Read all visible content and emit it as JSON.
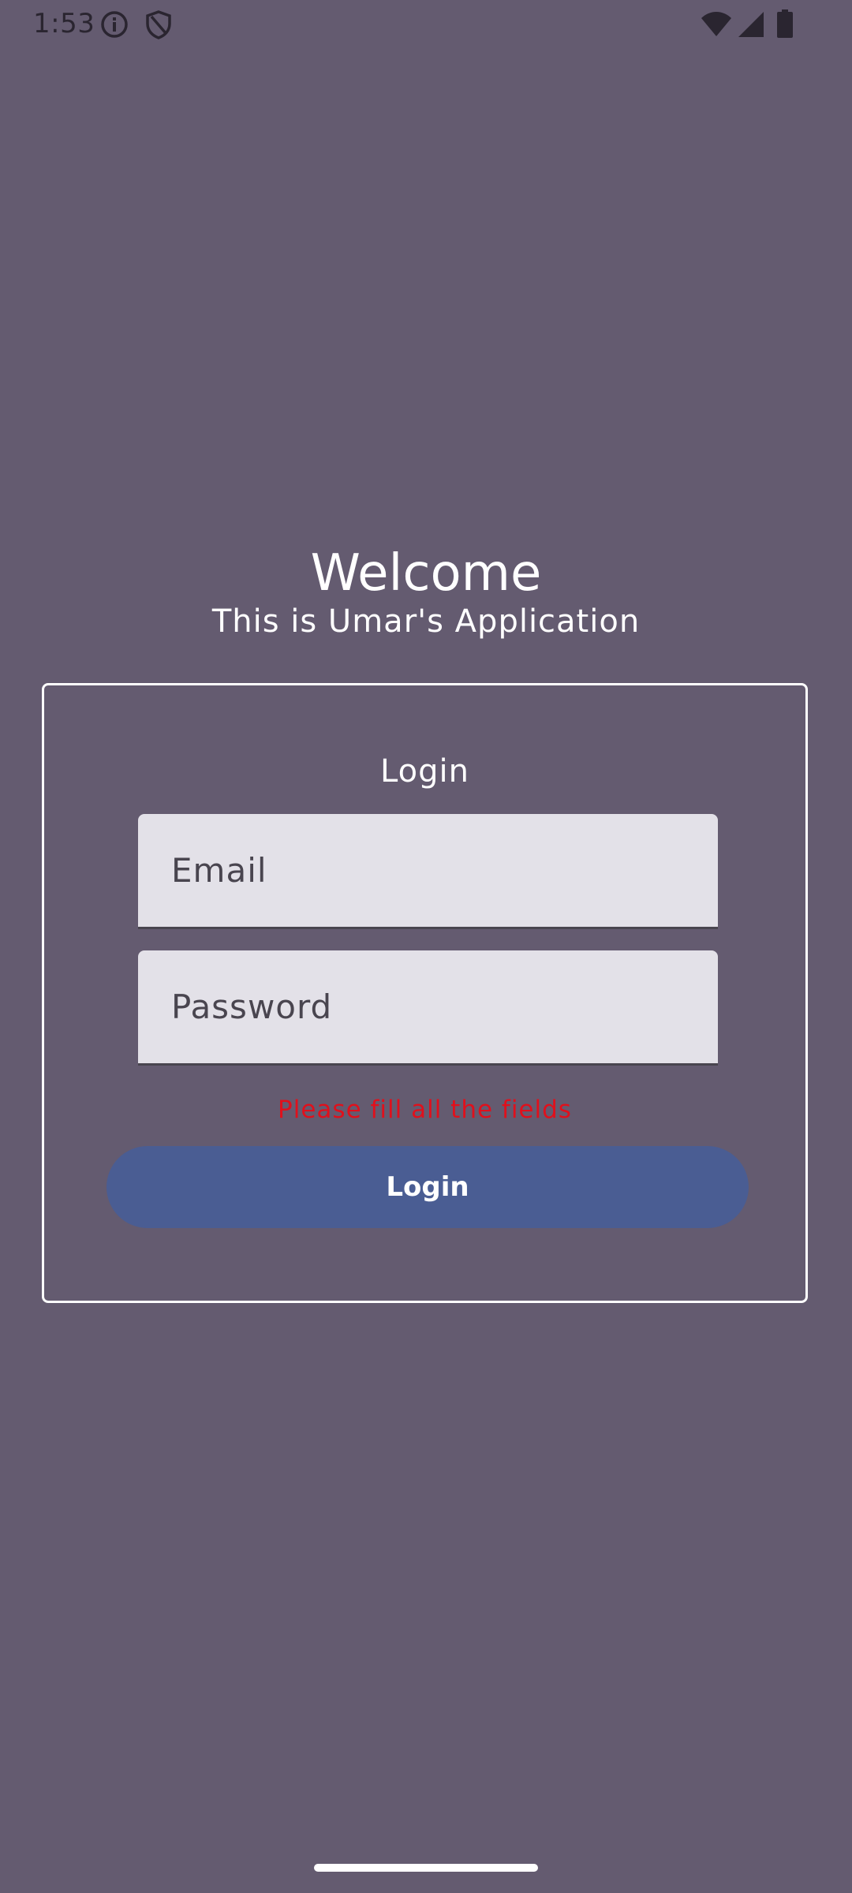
{
  "status_bar": {
    "time": "1:53",
    "icons": [
      "info-icon",
      "shield-icon",
      "wifi-icon",
      "signal-icon",
      "battery-icon"
    ]
  },
  "header": {
    "title": "Welcome",
    "subtitle": "This is Umar's Application"
  },
  "login_form": {
    "title": "Login",
    "email": {
      "placeholder": "Email",
      "value": ""
    },
    "password": {
      "placeholder": "Password",
      "value": ""
    },
    "error_message": "Please fill all the fields",
    "submit_label": "Login"
  },
  "colors": {
    "background": "#645b70",
    "field_background": "#e3e1e8",
    "button": "#4a5d93",
    "error": "#e0101c",
    "text": "#ffffff"
  }
}
